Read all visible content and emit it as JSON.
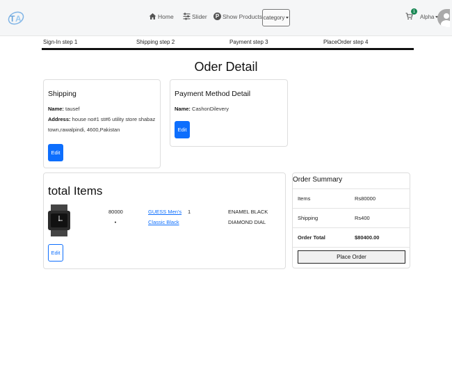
{
  "nav": {
    "home": "Home",
    "slider": "Slider",
    "products_badge": "P",
    "products": "Show Products",
    "category": "category",
    "cart_count": "1",
    "user": "Alpha"
  },
  "steps": [
    "Sign-In step 1",
    "Shipping step 2",
    "Payment step 3",
    "PlaceOrder step 4"
  ],
  "page_title": "Oder Detail",
  "shipping": {
    "title": "Shipping",
    "name_label": "Name:",
    "name": "tausef",
    "address_label": "Address:",
    "address_line1": "house no#1 st#6 utility store shabaz",
    "address_line2": "town,rawalpindi, 4600,Pakistan",
    "edit": "Edit"
  },
  "payment": {
    "title": "Payment Method Detail",
    "name_label": "Name:",
    "name": "CashonDilevery",
    "edit": "Edit"
  },
  "items": {
    "title": "total Items",
    "price": "80000",
    "dot": "•",
    "link_line1": "GUESS Men's",
    "link_line2": "Classic Black",
    "qty": "1",
    "desc_line1": "ENAMEL BLACK",
    "desc_line2": "DIAMOND DIAL",
    "edit": "Edit"
  },
  "summary": {
    "title": "Order Summary",
    "items_label": "Items",
    "items_value": "Rs80000",
    "shipping_label": "Shipping",
    "shipping_value": "Rs400",
    "total_label": "Order Total",
    "total_value": "$80400.00",
    "place_order": "Place Order"
  },
  "colors": {
    "primary": "#0d6efd",
    "cart_badge": "#198754",
    "step_bar": "#111111"
  }
}
